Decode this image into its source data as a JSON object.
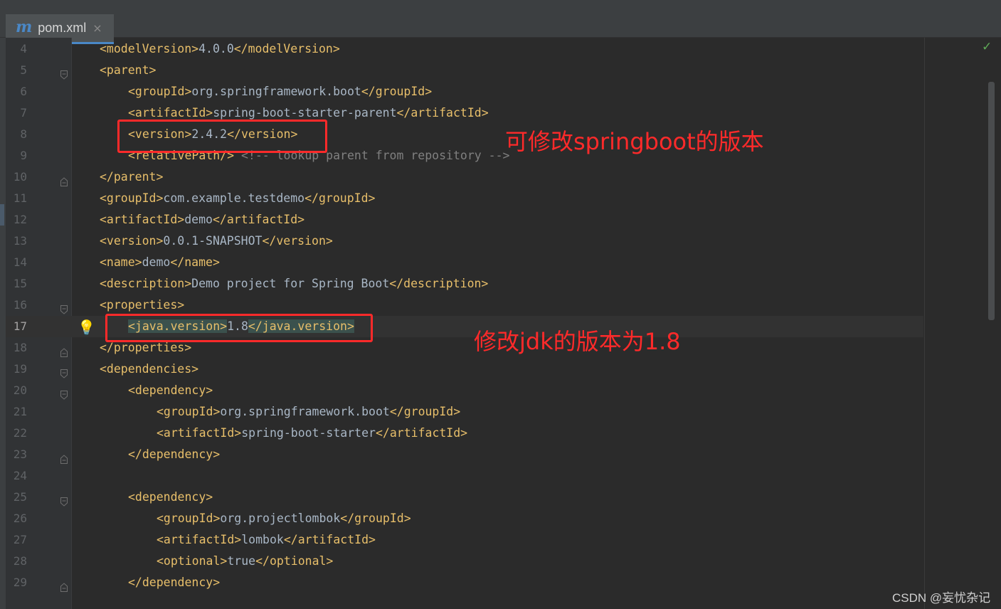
{
  "tab": {
    "icon": "m",
    "label": "pom.xml",
    "close": "×"
  },
  "gutter": {
    "bulb_icon": "lightbulb-icon",
    "bulb_glyph": "💡",
    "check_glyph": "✓"
  },
  "colors": {
    "tag": "#e8bf6a",
    "text": "#a9b7c6",
    "comment": "#808080",
    "annotation": "#ff2a2a",
    "background": "#2b2b2b"
  },
  "lines": [
    {
      "n": "4",
      "indent": 0,
      "open": "<modelVersion>",
      "text": "4.0.0",
      "close": "</modelVersion>"
    },
    {
      "n": "5",
      "indent": 0,
      "open": "<parent>",
      "fold": "open"
    },
    {
      "n": "6",
      "indent": 1,
      "open": "<groupId>",
      "text": "org.springframework.boot",
      "close": "</groupId>"
    },
    {
      "n": "7",
      "indent": 1,
      "open": "<artifactId>",
      "text": "spring-boot-starter-parent",
      "close": "</artifactId>"
    },
    {
      "n": "8",
      "indent": 1,
      "open": "<version>",
      "text": "2.4.2",
      "close": "</version>"
    },
    {
      "n": "9",
      "indent": 1,
      "open": "<relativePath/>",
      "comment": " <!-- lookup parent from repository -->"
    },
    {
      "n": "10",
      "indent": 0,
      "open": "</parent>",
      "fold": "close"
    },
    {
      "n": "11",
      "indent": 0,
      "open": "<groupId>",
      "text": "com.example.testdemo",
      "close": "</groupId>"
    },
    {
      "n": "12",
      "indent": 0,
      "open": "<artifactId>",
      "text": "demo",
      "close": "</artifactId>"
    },
    {
      "n": "13",
      "indent": 0,
      "open": "<version>",
      "text": "0.0.1-SNAPSHOT",
      "close": "</version>"
    },
    {
      "n": "14",
      "indent": 0,
      "open": "<name>",
      "text": "demo",
      "close": "</name>"
    },
    {
      "n": "15",
      "indent": 0,
      "open": "<description>",
      "text": "Demo project for Spring Boot",
      "close": "</description>"
    },
    {
      "n": "16",
      "indent": 0,
      "open": "<properties>",
      "fold": "open"
    },
    {
      "n": "17",
      "indent": 1,
      "open": "<java.version>",
      "text": "1.8",
      "close": "</java.version>",
      "current": true,
      "bulb": true
    },
    {
      "n": "18",
      "indent": 0,
      "open": "</properties>",
      "fold": "close"
    },
    {
      "n": "19",
      "indent": 0,
      "open": "<dependencies>",
      "fold": "open"
    },
    {
      "n": "20",
      "indent": 1,
      "open": "<dependency>",
      "fold": "open"
    },
    {
      "n": "21",
      "indent": 2,
      "open": "<groupId>",
      "text": "org.springframework.boot",
      "close": "</groupId>"
    },
    {
      "n": "22",
      "indent": 2,
      "open": "<artifactId>",
      "text": "spring-boot-starter",
      "close": "</artifactId>"
    },
    {
      "n": "23",
      "indent": 1,
      "open": "</dependency>",
      "fold": "close"
    },
    {
      "n": "24",
      "indent": 0
    },
    {
      "n": "25",
      "indent": 1,
      "open": "<dependency>",
      "fold": "open"
    },
    {
      "n": "26",
      "indent": 2,
      "open": "<groupId>",
      "text": "org.projectlombok",
      "close": "</groupId>"
    },
    {
      "n": "27",
      "indent": 2,
      "open": "<artifactId>",
      "text": "lombok",
      "close": "</artifactId>"
    },
    {
      "n": "28",
      "indent": 2,
      "open": "<optional>",
      "text": "true",
      "close": "</optional>"
    },
    {
      "n": "29",
      "indent": 1,
      "open": "</dependency>",
      "fold": "close"
    }
  ],
  "annotations": {
    "springboot_version": "可修改springboot的版本",
    "jdk_version": "修改jdk的版本为1.8"
  },
  "watermark": "CSDN @妄忧杂记"
}
